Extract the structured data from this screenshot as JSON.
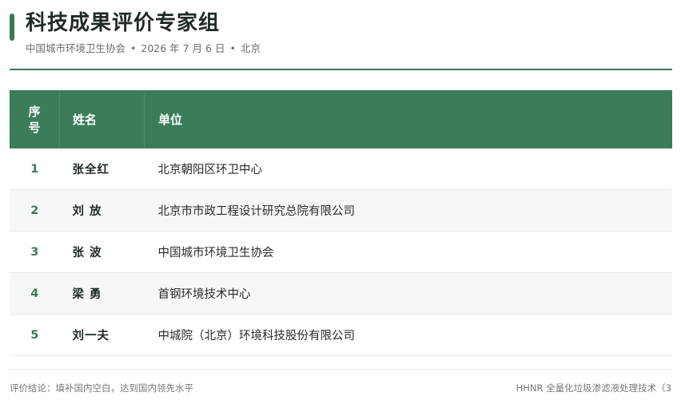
{
  "header": {
    "title": "科技成果评价专家组",
    "organizer": "中国城市环境卫生协会",
    "date": "2026 年 7 月 6 日",
    "location": "北京",
    "separator": "•",
    "accent_color": "#3a7a57"
  },
  "table": {
    "columns": {
      "no_line1": "序",
      "no_line2": "号",
      "name": "姓名",
      "unit": "单位"
    },
    "rows": [
      {
        "no": "1",
        "name": "张全红",
        "unit": "北京朝阳区环卫中心"
      },
      {
        "no": "2",
        "name": "刘 放",
        "unit": "北京市市政工程设计研究总院有限公司"
      },
      {
        "no": "3",
        "name": "张 波",
        "unit": "中国城市环境卫生协会"
      },
      {
        "no": "4",
        "name": "梁 勇",
        "unit": "首钢环境技术中心"
      },
      {
        "no": "5",
        "name": "刘一夫",
        "unit": "中城院（北京）环境科技股份有限公司"
      }
    ],
    "header_color": "#3b7d59"
  },
  "footer": {
    "conclusion": "评价结论：填补国内空白，达到国内领先水平",
    "project": "HHNR 全量化垃圾渗滤液处理技术（3"
  }
}
